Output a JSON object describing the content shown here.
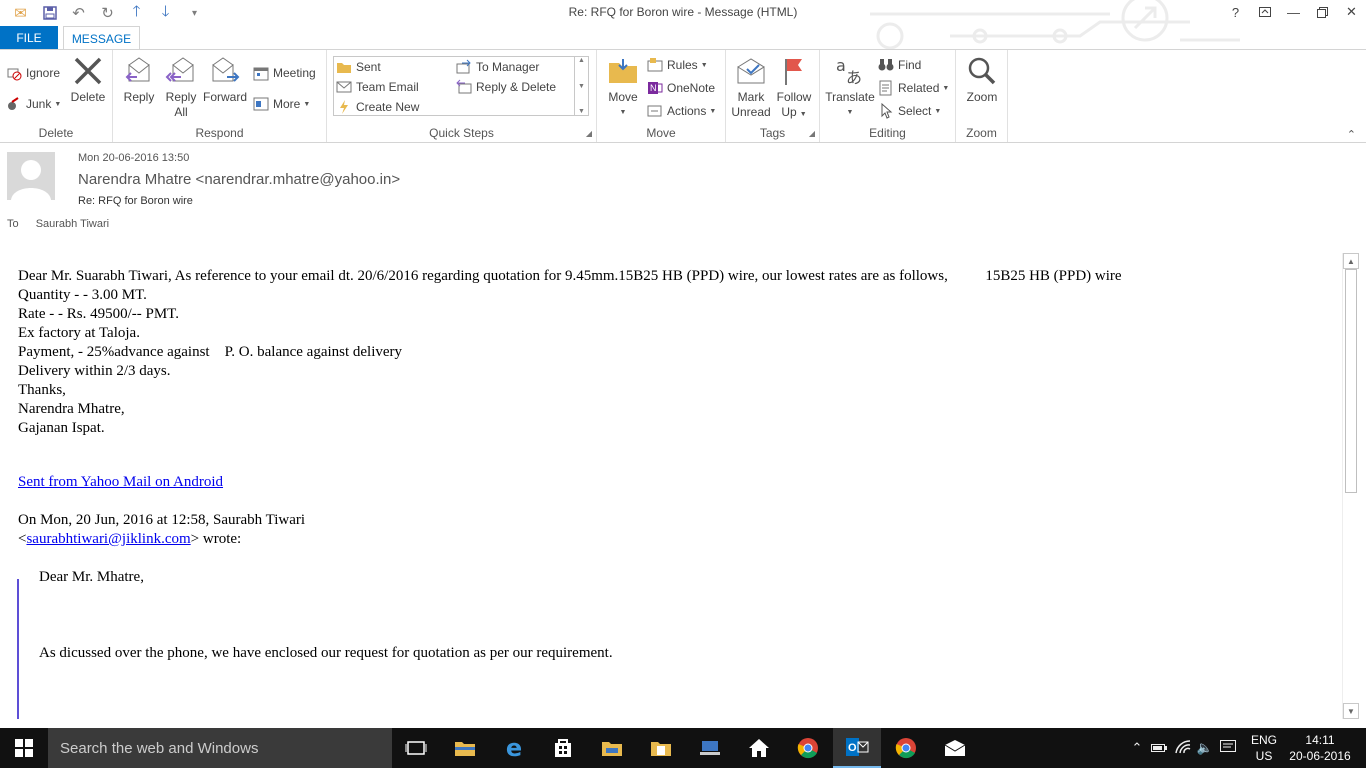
{
  "window": {
    "title": "Re: RFQ for Boron wire - Message (HTML)",
    "controls": [
      "?",
      "restore-ribbon",
      "minimize",
      "maximize",
      "close"
    ]
  },
  "tabs": [
    {
      "label": "FILE",
      "active": false
    },
    {
      "label": "MESSAGE",
      "active": true
    }
  ],
  "ribbon": {
    "delete": {
      "label": "Delete",
      "ignore": "Ignore",
      "junk": "Junk",
      "delete_btn": "Delete"
    },
    "respond": {
      "label": "Respond",
      "reply": "Reply",
      "reply_all_1": "Reply",
      "reply_all_2": "All",
      "forward": "Forward",
      "meeting": "Meeting",
      "more": "More"
    },
    "quicksteps": {
      "label": "Quick Steps",
      "sent": "Sent",
      "to_manager": "To Manager",
      "team_email": "Team Email",
      "reply_delete": "Reply & Delete",
      "create_new": "Create New"
    },
    "move": {
      "label": "Move",
      "move_btn": "Move",
      "rules": "Rules",
      "onenote": "OneNote",
      "actions": "Actions"
    },
    "tags": {
      "label": "Tags",
      "mark_1": "Mark",
      "mark_2": "Unread",
      "follow_1": "Follow",
      "follow_2": "Up"
    },
    "editing": {
      "label": "Editing",
      "translate": "Translate",
      "find": "Find",
      "related": "Related",
      "select": "Select"
    },
    "zoom": {
      "label": "Zoom",
      "zoom_btn": "Zoom"
    }
  },
  "header": {
    "date": "Mon 20-06-2016 13:50",
    "from": "Narendra Mhatre <narendrar.mhatre@yahoo.in>",
    "subject": "Re: RFQ for Boron wire",
    "to_label": "To",
    "to": "Saurabh Tiwari"
  },
  "body": {
    "line1": "Dear Mr. Suarabh Tiwari, As reference to your email dt. 20/6/2016 regarding quotation for 9.45mm.15B25 HB (PPD) wire, our lowest rates are as follows,          15B25 HB (PPD) wire",
    "line2": "Quantity - - 3.00 MT.",
    "line3": "Rate - - Rs. 49500/-- PMT.",
    "line4": "Ex factory at Taloja.",
    "line5": "Payment, - 25%advance against    P. O. balance against delivery",
    "line6": "Delivery within 2/3 days.",
    "line7": "Thanks,",
    "line8": "Narendra Mhatre,",
    "line9": "Gajanan Ispat.",
    "yahoo_link": "Sent from Yahoo Mail on Android",
    "on_line": "On Mon, 20 Jun, 2016 at 12:58, Saurabh Tiwari",
    "email_open": "<",
    "email_link": "saurabhtiwari@jiklink.com",
    "email_close": "> wrote:",
    "quote_greeting": "Dear Mr. Mhatre,",
    "quote_text": "As dicussed over the phone, we have enclosed our request for quotation as per our requirement."
  },
  "taskbar": {
    "search_placeholder": "Search the web and Windows",
    "lang_1": "ENG",
    "lang_2": "US",
    "time": "14:11",
    "date": "20-06-2016"
  },
  "colors": {
    "accent": "#0072c6",
    "quote_bar": "#5d4fd6",
    "link": "#0000ee",
    "taskbar": "#111111",
    "search_box": "#3a3a3a"
  }
}
